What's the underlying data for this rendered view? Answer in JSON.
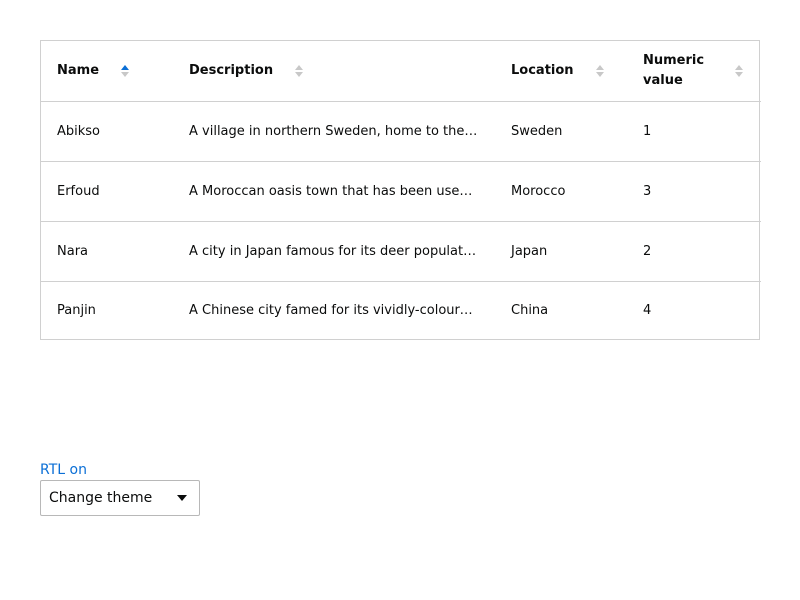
{
  "table": {
    "columns": [
      {
        "label": "Name",
        "sort": "ascending"
      },
      {
        "label": "Description",
        "sort": "none"
      },
      {
        "label": "Location",
        "sort": "none"
      },
      {
        "label": "Numeric value",
        "sort": "none"
      }
    ],
    "rows": [
      {
        "name": "Abikso",
        "description": "A village in northern Sweden, home to the Climate Impacts Research Centre.",
        "location": "Sweden",
        "value": "1"
      },
      {
        "name": "Erfoud",
        "description": "A Moroccan oasis town that has been used as a filming location.",
        "location": "Morocco",
        "value": "3"
      },
      {
        "name": "Nara",
        "description": "A city in Japan famous for its deer population.",
        "location": "Japan",
        "value": "2"
      },
      {
        "name": "Panjin",
        "description": "A Chinese city famed for its vividly-coloured red beach.",
        "location": "China",
        "value": "4"
      }
    ]
  },
  "controls": {
    "rtl_label": "RTL on",
    "theme_label": "Change theme"
  },
  "colors": {
    "accent": "#0b6fd6",
    "border": "#d0d0d0",
    "inactive_sort": "#c8c8c8"
  }
}
